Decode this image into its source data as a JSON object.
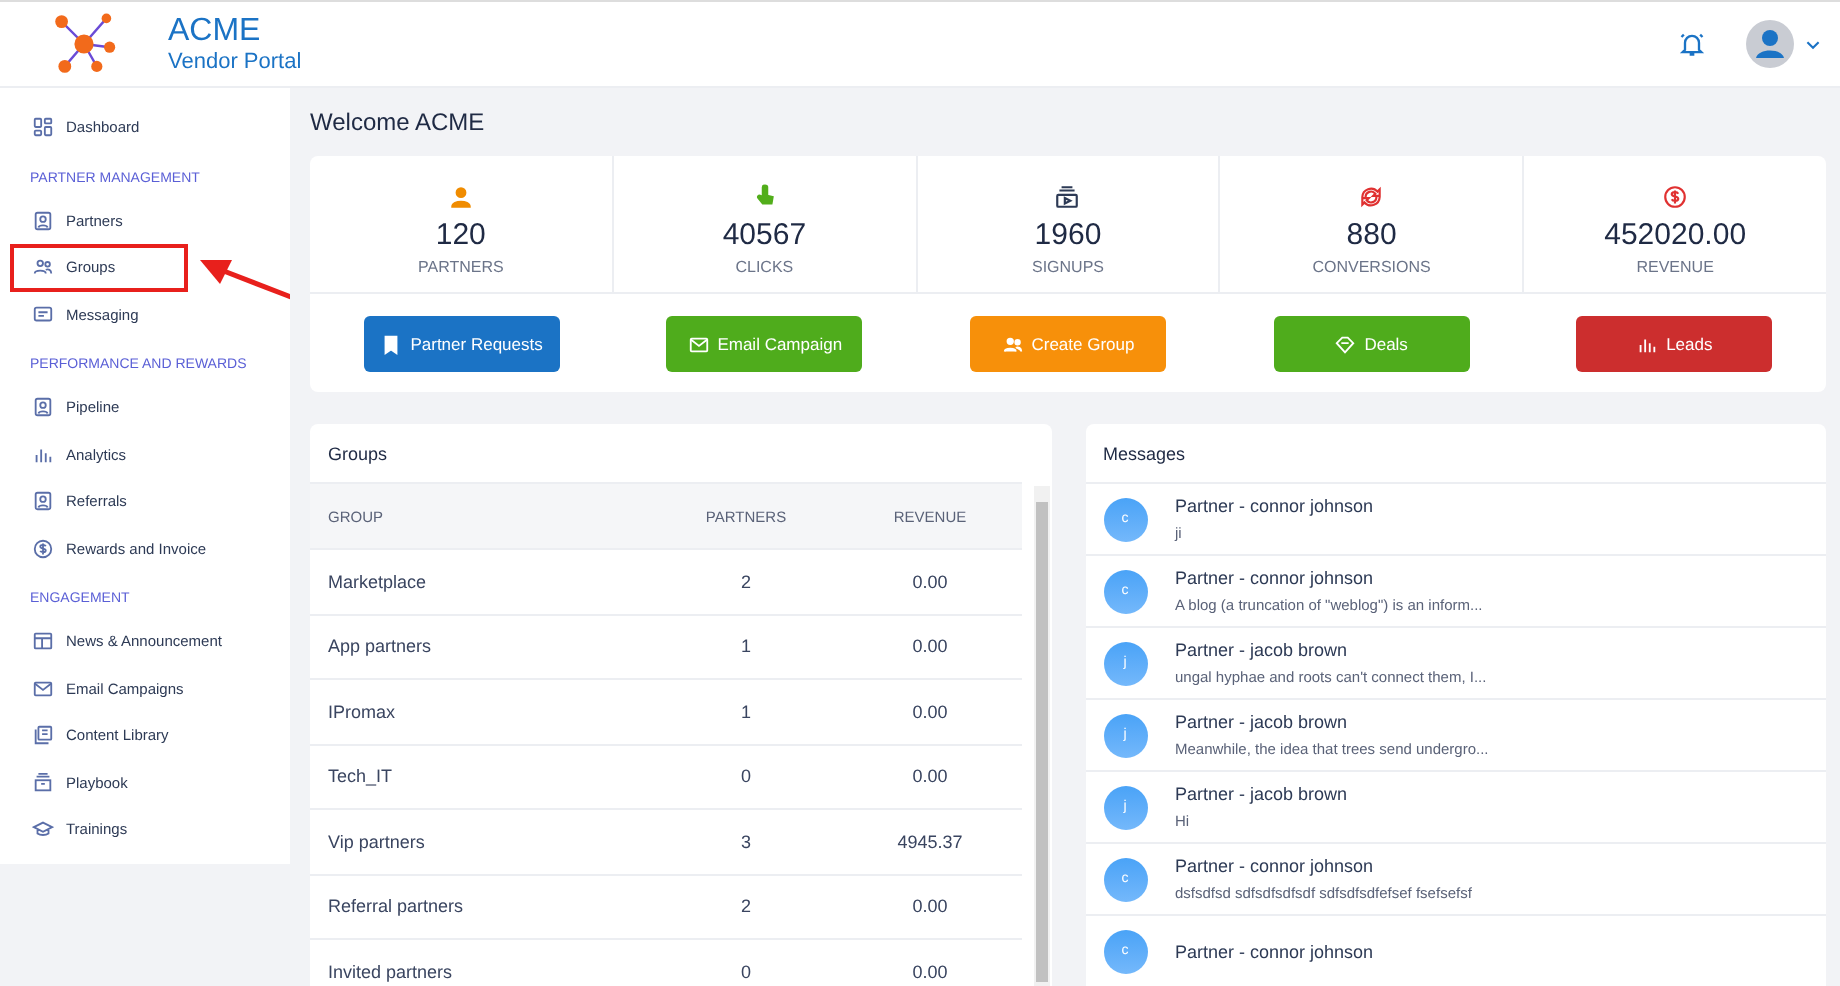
{
  "header": {
    "brand": "ACME",
    "subtitle": "Vendor Portal"
  },
  "sidebar": {
    "sections": [
      {
        "items": [
          {
            "label": "Dashboard",
            "highlighted": false
          }
        ]
      },
      {
        "heading": "PARTNER MANAGEMENT",
        "items": [
          {
            "label": "Partners",
            "highlighted": false
          },
          {
            "label": "Groups",
            "highlighted": true
          },
          {
            "label": "Messaging",
            "highlighted": false
          }
        ]
      },
      {
        "heading": "PERFORMANCE AND REWARDS",
        "items": [
          {
            "label": "Pipeline",
            "highlighted": false
          },
          {
            "label": "Analytics",
            "highlighted": false
          },
          {
            "label": "Referrals",
            "highlighted": false
          },
          {
            "label": "Rewards and Invoice",
            "highlighted": false
          }
        ]
      },
      {
        "heading": "ENGAGEMENT",
        "items": [
          {
            "label": "News & Announcement",
            "highlighted": false
          },
          {
            "label": "Email Campaigns",
            "highlighted": false
          },
          {
            "label": "Content Library",
            "highlighted": false
          },
          {
            "label": "Playbook",
            "highlighted": false
          },
          {
            "label": "Trainings",
            "highlighted": false
          }
        ]
      }
    ]
  },
  "welcome": "Welcome ACME",
  "stats": [
    {
      "value": "120",
      "label": "PARTNERS",
      "color": "#f08c00"
    },
    {
      "value": "40567",
      "label": "CLICKS",
      "color": "#52ae1b"
    },
    {
      "value": "1960",
      "label": "SIGNUPS",
      "color": "#2d3a55"
    },
    {
      "value": "880",
      "label": "CONVERSIONS",
      "color": "#e03131"
    },
    {
      "value": "452020.00",
      "label": "REVENUE",
      "color": "#e03131"
    }
  ],
  "actions": [
    {
      "label": "Partner Requests",
      "color": "#1b73c5"
    },
    {
      "label": "Email Campaign",
      "color": "#4fac1c"
    },
    {
      "label": "Create Group",
      "color": "#f7900a"
    },
    {
      "label": "Deals",
      "color": "#4fac1c"
    },
    {
      "label": "Leads",
      "color": "#cc2e2e"
    }
  ],
  "groups": {
    "title": "Groups",
    "columns": [
      "GROUP",
      "PARTNERS",
      "REVENUE"
    ],
    "rows": [
      [
        "Marketplace",
        "2",
        "0.00"
      ],
      [
        "App partners",
        "1",
        "0.00"
      ],
      [
        "IPromax",
        "1",
        "0.00"
      ],
      [
        "Tech_IT",
        "0",
        "0.00"
      ],
      [
        "Vip partners",
        "3",
        "4945.37"
      ],
      [
        "Referral partners",
        "2",
        "0.00"
      ],
      [
        "Invited partners",
        "0",
        "0.00"
      ]
    ]
  },
  "messages": {
    "title": "Messages",
    "items": [
      {
        "initial": "c",
        "title": "Partner - connor johnson",
        "preview": "ji"
      },
      {
        "initial": "c",
        "title": "Partner - connor johnson",
        "preview": "A blog (a truncation of \"weblog\") is an inform..."
      },
      {
        "initial": "j",
        "title": "Partner - jacob brown",
        "preview": "ungal hyphae and roots can't connect them, I..."
      },
      {
        "initial": "j",
        "title": "Partner - jacob brown",
        "preview": "Meanwhile, the idea that trees send undergro..."
      },
      {
        "initial": "j",
        "title": "Partner - jacob brown",
        "preview": "Hi"
      },
      {
        "initial": "c",
        "title": "Partner - connor johnson",
        "preview": "dsfsdfsd sdfsdfsdfsdf sdfsdfsdfefsef fsefsefsf"
      },
      {
        "initial": "c",
        "title": "Partner - connor johnson"
      }
    ]
  }
}
